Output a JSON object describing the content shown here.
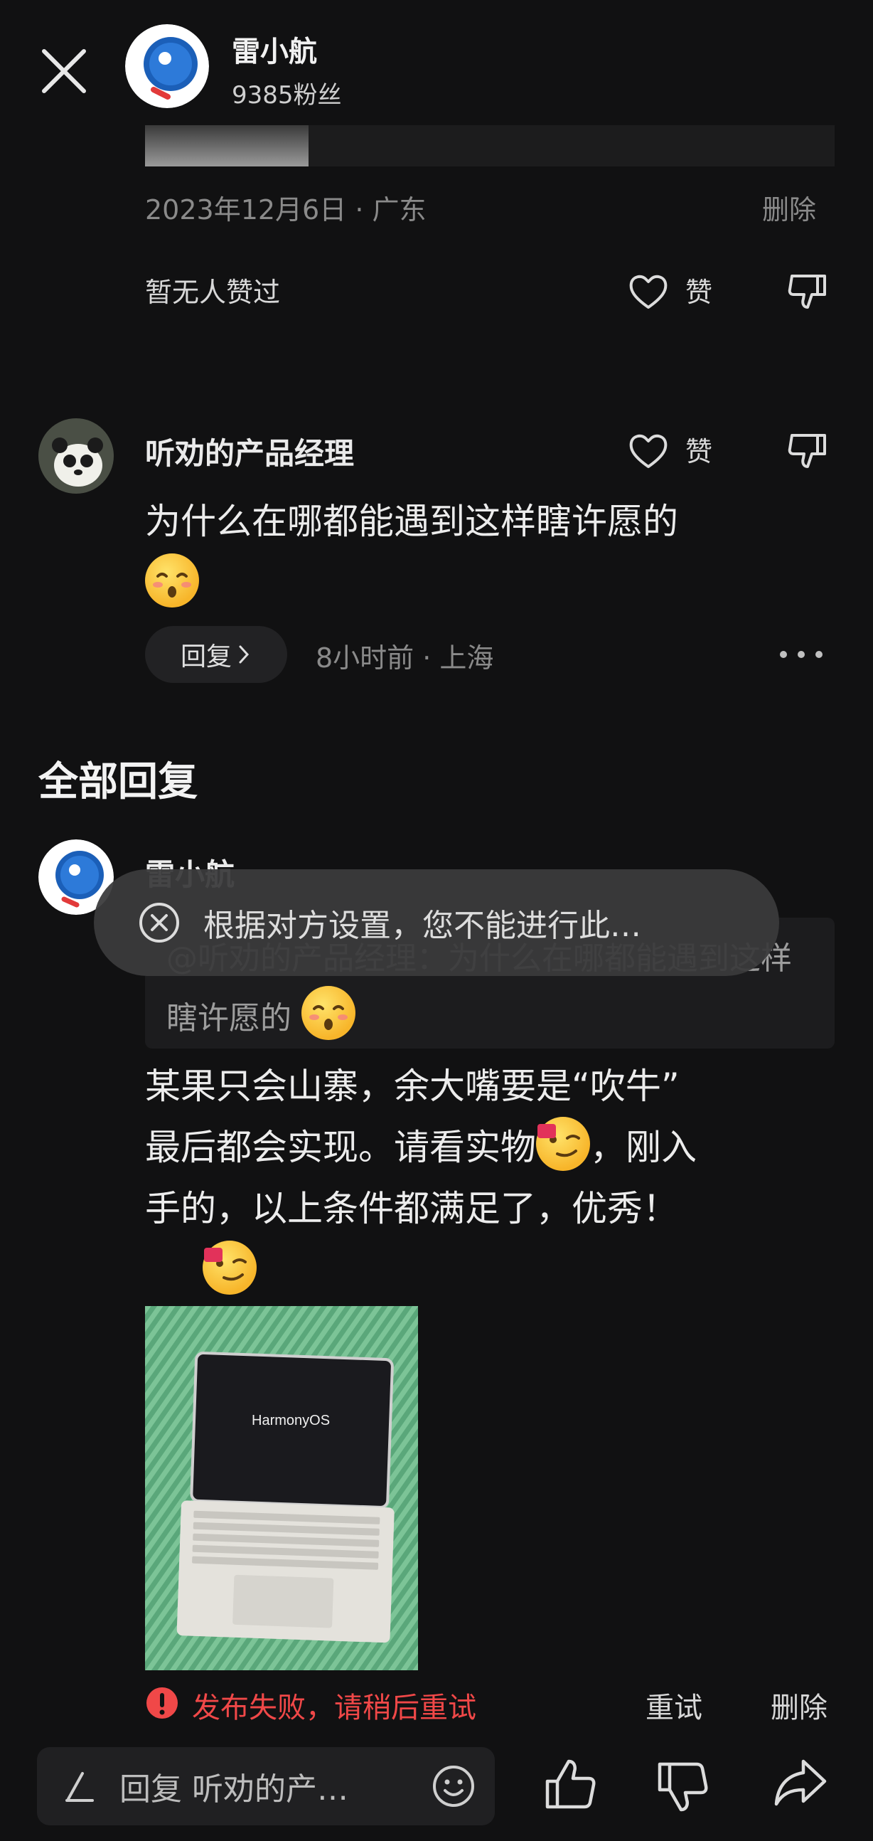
{
  "header": {
    "username": "雷小航",
    "fans": "9385粉丝"
  },
  "post_meta": {
    "date_location": "2023年12月6日 · 广东",
    "delete_label": "删除",
    "no_likes": "暂无人赞过",
    "like_label": "赞"
  },
  "comment": {
    "author": "听劝的产品经理",
    "text": "为什么在哪都能遇到这样瞎许愿的",
    "emoji": "flushed-face",
    "reply_label": "回复",
    "time_location": "8小时前 · 上海",
    "like_label": "赞"
  },
  "replies_section": {
    "title": "全部回复"
  },
  "reply": {
    "author": "雷小航",
    "quote": "@听劝的产品经理：为什么在哪都能遇到这样瞎许愿的",
    "text_lines": [
      "某果只会山寨，余大嘴要是“吹牛”",
      "最后都会实现。请看实物",
      "，刚入",
      "手的，以上条件都满足了，优秀！"
    ],
    "photo_caption": "HarmonyOS",
    "fail_message": "发布失败，请稍后重试",
    "retry_label": "重试",
    "delete_label": "删除"
  },
  "toast": {
    "text": "根据对方设置，您不能进行此…"
  },
  "bottom_bar": {
    "input_text": "回复 听劝的产…"
  },
  "colors": {
    "background": "#111112",
    "error": "#f04848"
  }
}
